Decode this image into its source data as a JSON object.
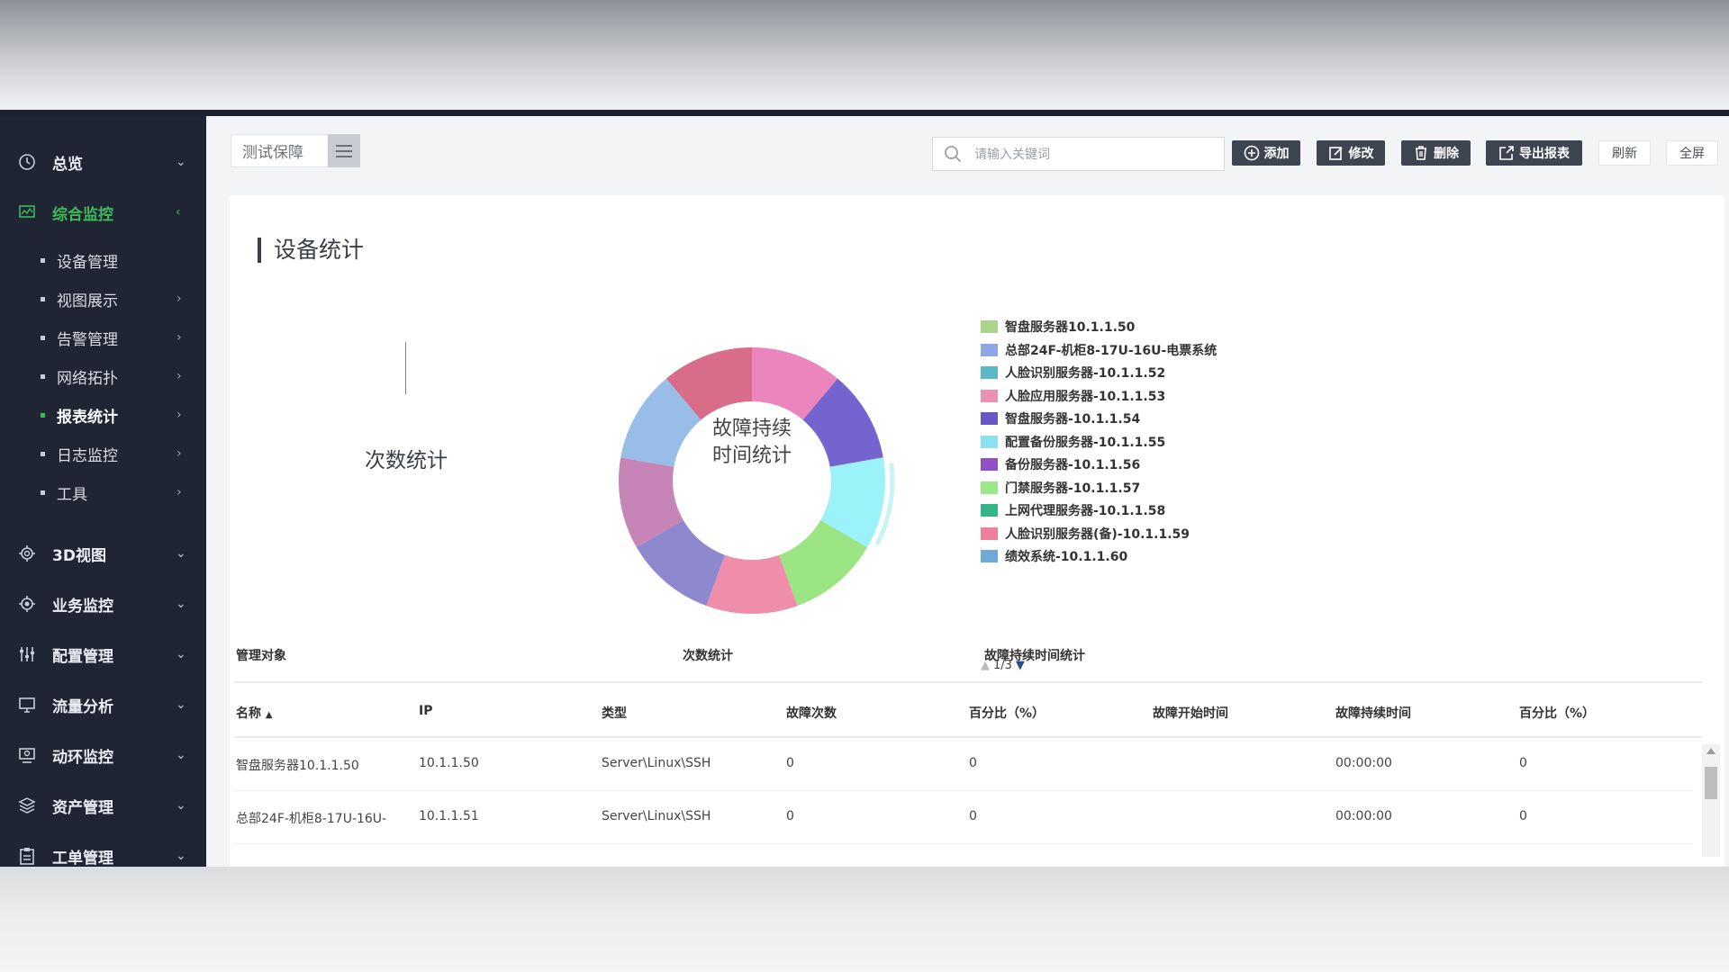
{
  "sidebar": {
    "items": [
      {
        "label": "总览",
        "icon": "clock-icon",
        "arrow": "⌄"
      },
      {
        "label": "综合监控",
        "icon": "monitor-chart-icon",
        "arrow": "‹",
        "active": true
      },
      {
        "label": "3D视图",
        "icon": "gear-3d-icon",
        "arrow": "⌄"
      },
      {
        "label": "业务监控",
        "icon": "gear-icon",
        "arrow": "⌄"
      },
      {
        "label": "配置管理",
        "icon": "sliders-icon",
        "arrow": "⌄"
      },
      {
        "label": "流量分析",
        "icon": "monitor-icon",
        "arrow": "⌄"
      },
      {
        "label": "动环监控",
        "icon": "monitor-env-icon",
        "arrow": "⌄"
      },
      {
        "label": "资产管理",
        "icon": "layers-icon",
        "arrow": "⌄"
      },
      {
        "label": "工单管理",
        "icon": "clipboard-icon",
        "arrow": "⌄"
      }
    ],
    "subitems": [
      {
        "label": "设备管理",
        "arrow": ""
      },
      {
        "label": "视图展示",
        "arrow": "›"
      },
      {
        "label": "告警管理",
        "arrow": "›"
      },
      {
        "label": "网络拓扑",
        "arrow": "›"
      },
      {
        "label": "报表统计",
        "arrow": "›",
        "current": true
      },
      {
        "label": "日志监控",
        "arrow": "›"
      },
      {
        "label": "工具",
        "arrow": "›"
      }
    ]
  },
  "toolbar": {
    "tag": "测试保障",
    "search_placeholder": "请输入关键词",
    "add_label": "添加",
    "edit_label": "修改",
    "delete_label": "删除",
    "export_label": "导出报表",
    "refresh_label": "刷新",
    "fullscreen_label": "全屏"
  },
  "card": {
    "title": "设备统计",
    "count_label": "次数统计",
    "donut_center_line1": "故障持续",
    "donut_center_line2": "时间统计"
  },
  "chart_data": {
    "type": "pie",
    "title": "故障持续时间统计",
    "legend_position": "right",
    "legend_pager": "1/3",
    "categories": [
      "智盘服务器10.1.1.50",
      "总部24F-机柜8-17U-16U-电票系统",
      "人脸识别服务器-10.1.1.52",
      "人脸应用服务器-10.1.1.53",
      "智盘服务器-10.1.1.54",
      "配置备份服务器-10.1.1.55",
      "备份服务器-10.1.1.56",
      "门禁服务器-10.1.1.57",
      "上网代理服务器-10.1.1.58",
      "人脸识别服务器(备)-10.1.1.59",
      "绩效系统-10.1.1.60"
    ],
    "colors": [
      "#a9d48a",
      "#8fa5e6",
      "#5bb8c9",
      "#ee8fb6",
      "#6659c7",
      "#8be0f2",
      "#9150c7",
      "#9be887",
      "#33b585",
      "#ef7f9a",
      "#6ea9d8"
    ],
    "slices": [
      {
        "color": "#ea86bd",
        "value": 1
      },
      {
        "color": "#7564cf",
        "value": 1
      },
      {
        "color": "#9cf2f9",
        "value": 1
      },
      {
        "color": "#9ce584",
        "value": 1
      },
      {
        "color": "#ef8eaa",
        "value": 1
      },
      {
        "color": "#8e88cf",
        "value": 1
      },
      {
        "color": "#c684b7",
        "value": 1
      },
      {
        "color": "#98bde6",
        "value": 1
      },
      {
        "color": "#d96d89",
        "value": 1
      }
    ]
  },
  "table": {
    "groups": [
      "管理对象",
      "次数统计",
      "故障持续时间统计"
    ],
    "headers": [
      "名称",
      "IP",
      "类型",
      "故障次数",
      "百分比（%）",
      "故障开始时间",
      "故障持续时间",
      "百分比（%）"
    ],
    "sort_indicator": "▲",
    "rows": [
      [
        "智盘服务器10.1.1.50",
        "10.1.1.50",
        "Server\\Linux\\SSH",
        "0",
        "0",
        "",
        "00:00:00",
        "0"
      ],
      [
        "总部24F-机柜8-17U-16U-",
        "10.1.1.51",
        "Server\\Linux\\SSH",
        "0",
        "0",
        "",
        "00:00:00",
        "0"
      ]
    ]
  }
}
